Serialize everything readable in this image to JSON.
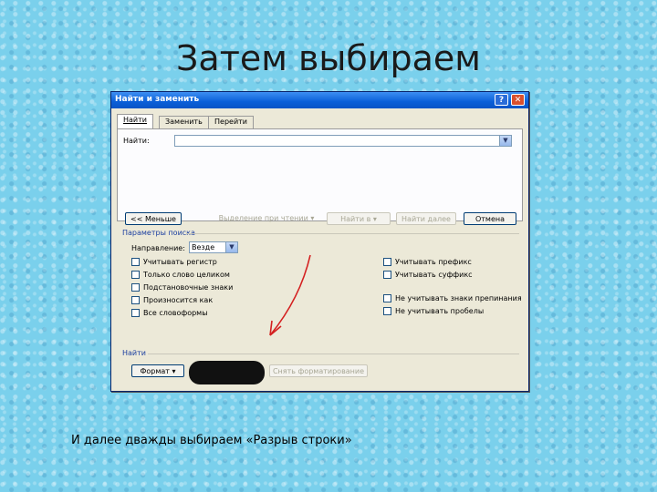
{
  "slide": {
    "title": "Затем выбираем",
    "caption": "И далее  дважды выбираем «Разрыв строки»"
  },
  "dialog": {
    "title": "Найти и заменить",
    "help_button": "?",
    "close_button": "✕",
    "tabs": [
      {
        "label": "Найти",
        "active": true
      },
      {
        "label": "Заменить",
        "active": false
      },
      {
        "label": "Перейти",
        "active": false
      }
    ],
    "find_label": "Найти:",
    "find_value": "",
    "buttons": {
      "less": "<< Меньше",
      "selection": "Выделение при чтении",
      "find_in": "Найти в",
      "find_next": "Найти далее",
      "cancel": "Отмена",
      "format": "Формат",
      "no_formatting": "Снять форматирование"
    },
    "search_options_caption": "Параметры поиска",
    "direction_label": "Направление:",
    "direction_value": "Везде",
    "options_left": [
      "Учитывать регистр",
      "Только слово целиком",
      "Подстановочные знаки",
      "Произносится как",
      "Все словоформы"
    ],
    "options_right_top": [
      "Учитывать префикс",
      "Учитывать суффикс"
    ],
    "options_right_bottom": [
      "Не учитывать знаки препинания",
      "Не учитывать пробелы"
    ],
    "find_group_caption": "Найти"
  },
  "colors": {
    "background": "#7ad0ec",
    "titlebar": "#0a5fd8",
    "dialog": "#ece9d8",
    "annotation_arrow": "#d42020"
  },
  "icons": {
    "help": "help-icon",
    "close": "close-icon",
    "dropdown": "chevron-down-icon"
  }
}
